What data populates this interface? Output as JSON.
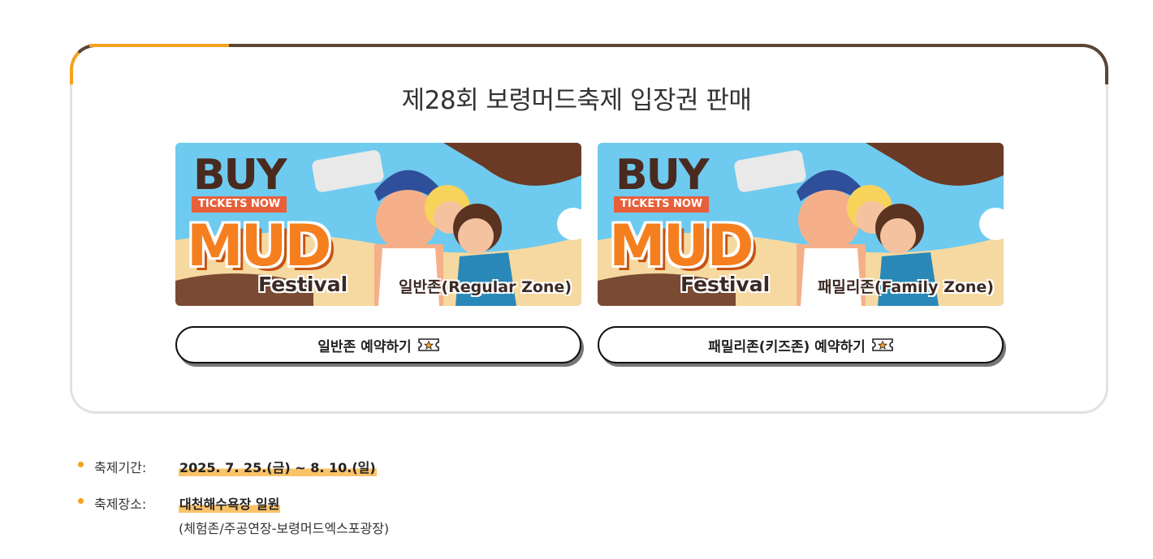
{
  "title": "제28회 보령머드축제 입장권 판매",
  "banners": [
    {
      "buy": "BUY",
      "tickets_now": "TICKETS NOW",
      "logo_word": "MUD",
      "festival": "Festival",
      "zone": "일반존(Regular Zone)",
      "button_label": "일반존 예약하기",
      "button_icon": "ticket-icon"
    },
    {
      "buy": "BUY",
      "tickets_now": "TICKETS NOW",
      "logo_word": "MUD",
      "festival": "Festival",
      "zone": "패밀리존(Family Zone)",
      "button_label": "패밀리존(키즈존) 예약하기",
      "button_icon": "ticket-icon"
    }
  ],
  "info": {
    "period_label": "축제기간:",
    "period_value": "2025. 7. 25.(금) ~ 8. 10.(일)",
    "venue_label": "축제장소:",
    "venue_value": "대천해수욕장 일원",
    "venue_sub": "(체험존/주공연장-보령머드엑스포광장)"
  },
  "colors": {
    "accent": "#f4a21f",
    "frame_dark": "#5b4535",
    "highlight": "#fbc368",
    "mud_orange": "#f57f1f",
    "sky": "#58c3ef"
  }
}
